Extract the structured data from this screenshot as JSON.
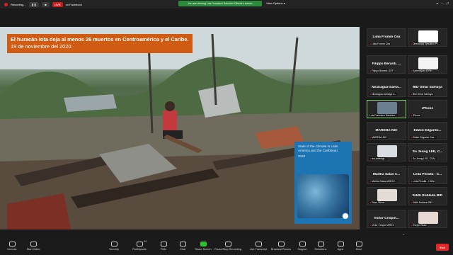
{
  "topbar": {
    "recording": "Recording...",
    "live": "LIVE",
    "on_facebook": "on Facebook",
    "banner": "You are viewing Luis Francisco Sánchez Olivera's screen",
    "view_options": "View Options"
  },
  "slide": {
    "headline": "El huracán Iota deja al menos 26 muertos en Centroamérica y el Caribe.",
    "date": "19 de noviembre del 2020.",
    "report_title": "State of the Climate in Latin America and the Caribbean",
    "report_year": "2020"
  },
  "gallery": [
    {
      "name": "Lidia Fromm Cea",
      "label": "Lidia Fromm Cea",
      "type": "name"
    },
    {
      "name": "",
      "label": "Director(a) Ejecutivo Pr...",
      "type": "logo"
    },
    {
      "name": "Filippo  Berardi_...",
      "label": "Filippo Berardi_GEF",
      "type": "name"
    },
    {
      "name": "",
      "label": "Karlenzijaer-EIRM",
      "type": "logo"
    },
    {
      "name": "Nicaragua-Sama...",
      "label": "Nicaragua-Samaya C...",
      "type": "name"
    },
    {
      "name": "BID Omar Samaya",
      "label": "BID Omar Samaya",
      "type": "name"
    },
    {
      "name": "",
      "label": "Luis Francisco Sánchez...",
      "type": "video"
    },
    {
      "name": "iPhone",
      "label": "iPhone",
      "type": "name"
    },
    {
      "name": "MARENA-NIC",
      "label": "MARENA-NIC",
      "type": "name"
    },
    {
      "name": "Edwin  Edgardo...",
      "label": "Edwin Edgardo Cas...",
      "type": "name"
    },
    {
      "name": "",
      "label": "ma.ameragr...",
      "type": "video"
    },
    {
      "name": "So Jeong LEE, C...",
      "label": "So Jeong LEE, CDAL",
      "type": "name"
    },
    {
      "name": "Martha Salas A...",
      "label": "Martha Salas AMEXC...",
      "type": "name"
    },
    {
      "name": "Leda Peralta - C...",
      "label": "Leda Peralta - CDAL",
      "type": "name"
    },
    {
      "name": "",
      "label": "Rosa Olivos",
      "type": "video"
    },
    {
      "name": "Edith Robledo BID",
      "label": "Edith Robledo BID",
      "type": "name"
    },
    {
      "name": "Victor  Crispin...",
      "label": "Victor Crispin MIREX",
      "type": "name"
    },
    {
      "name": "",
      "label": "Evelyn Wiarz",
      "type": "video"
    }
  ],
  "toolbar": {
    "unmute": "Unmute",
    "start_video": "Start Video",
    "security": "Security",
    "participants": "Participants",
    "participants_count": "44",
    "polls": "Polls",
    "chat": "Chat",
    "share_screen": "Share Screen",
    "pause_stop_recording": "Pause/Stop Recording",
    "live_transcript": "Live Transcript",
    "breakout_rooms": "Breakout Rooms",
    "support": "Support",
    "reactions": "Reactions",
    "apps": "Apps",
    "more": "More",
    "end": "End"
  },
  "colors": {
    "headline_bg": "#d05b12",
    "report_bg": "#1d74b3",
    "share_green": "#2cc22c",
    "end_red": "#e02828",
    "banner_green": "#2a8c3c"
  }
}
